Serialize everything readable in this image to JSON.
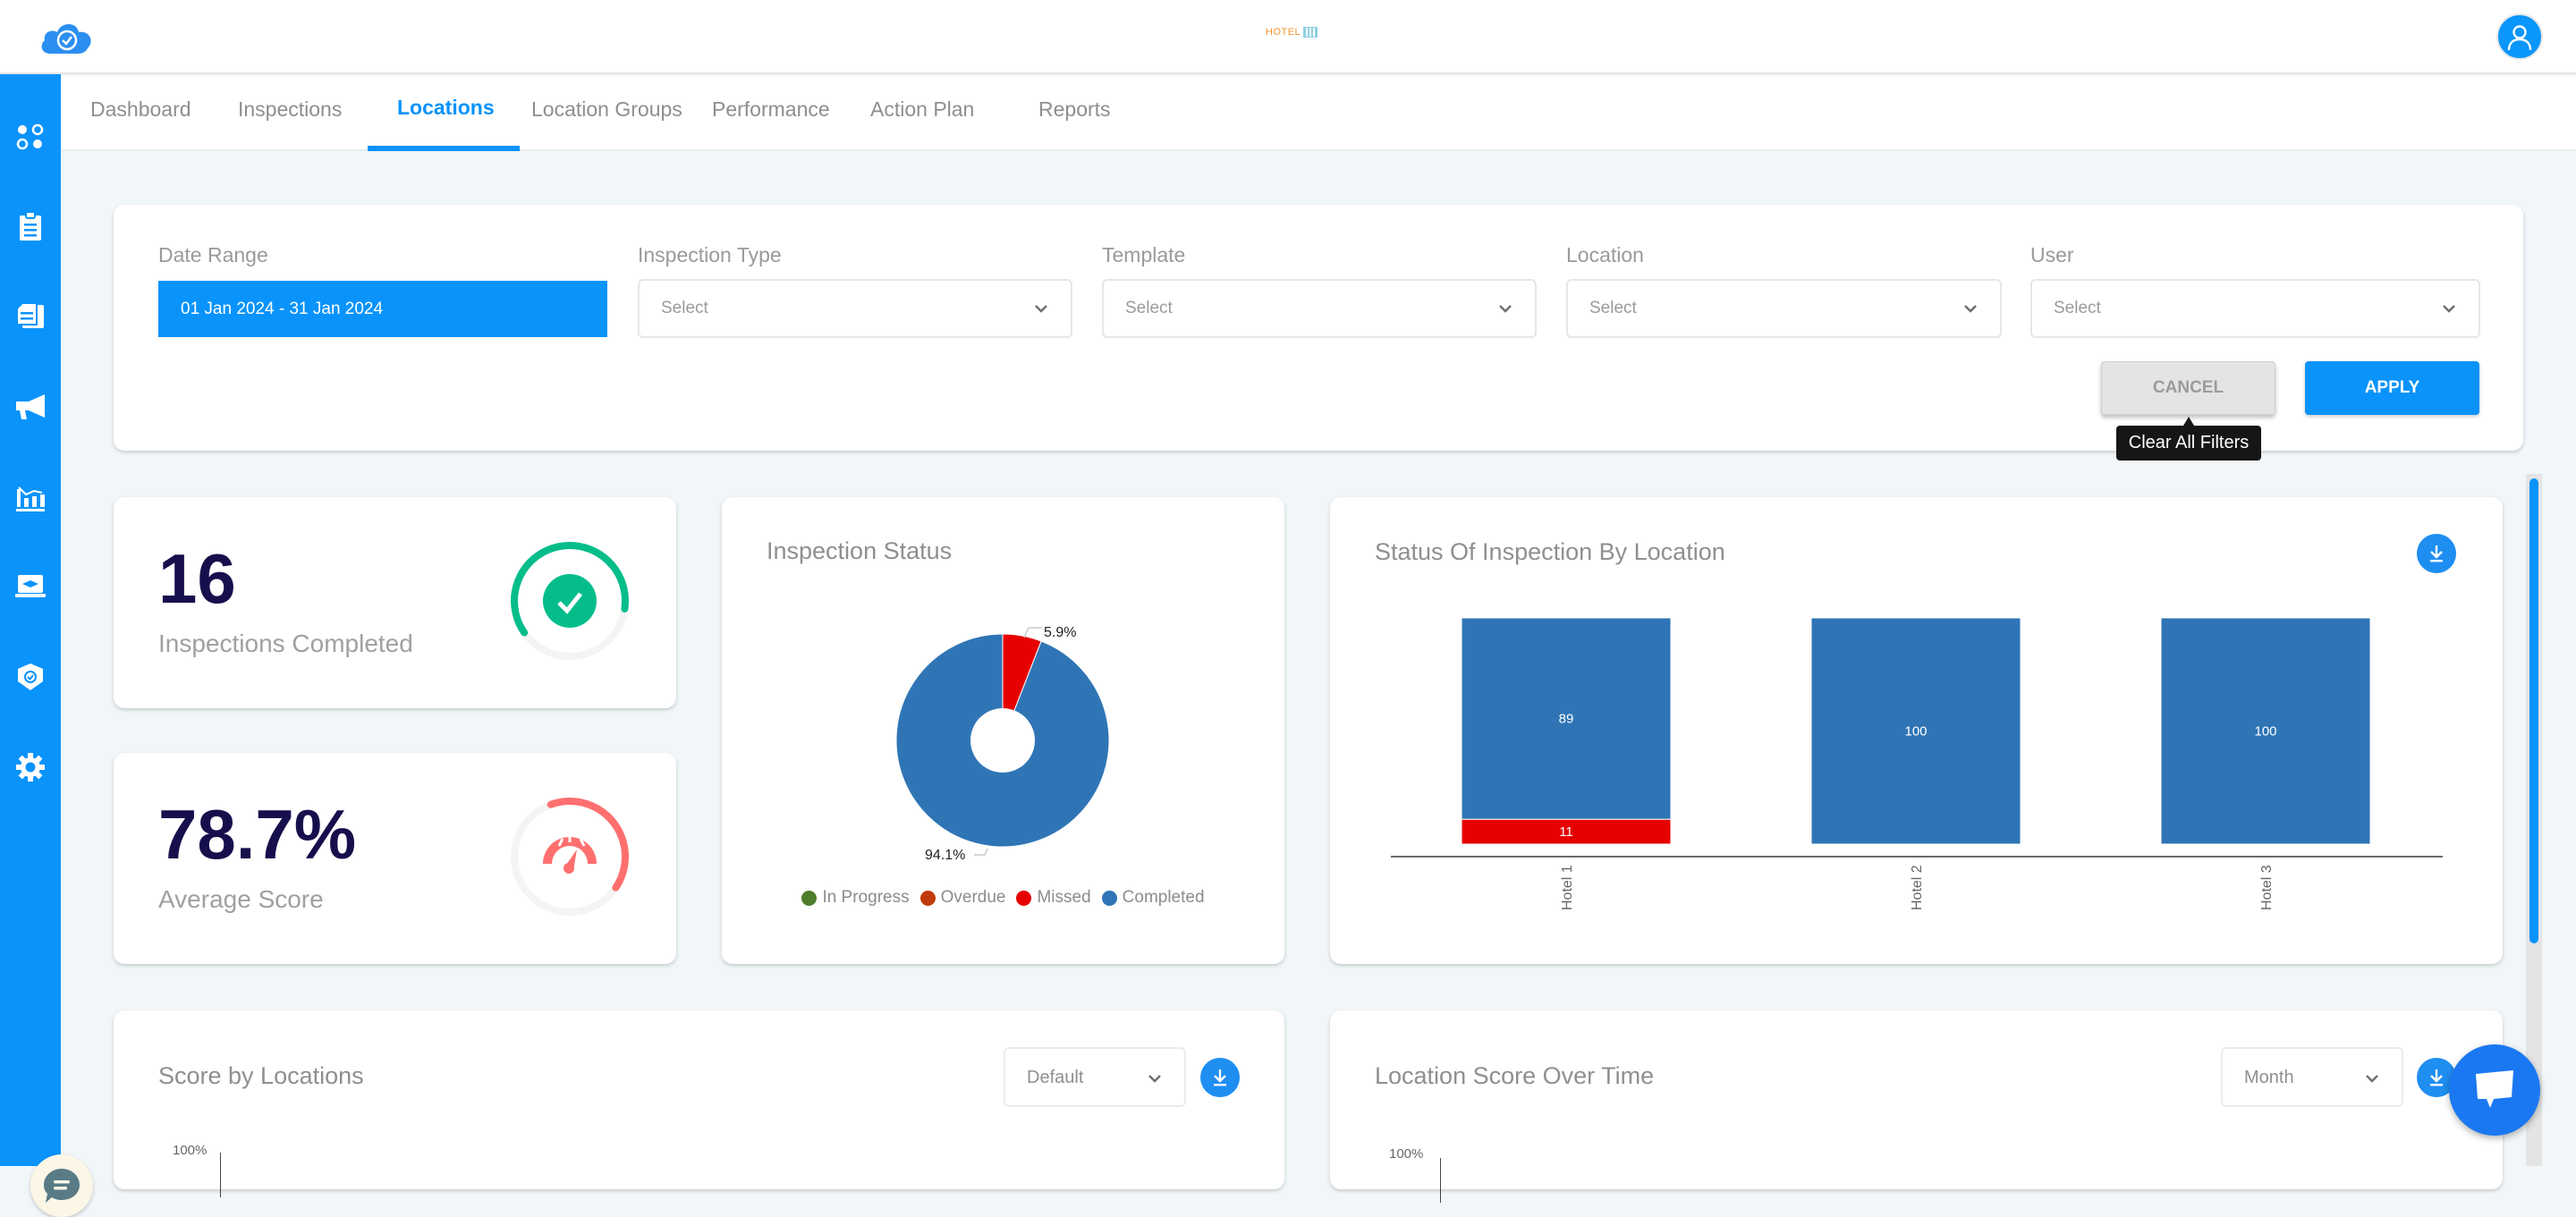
{
  "header": {
    "hotel_logo_text": "HOTEL",
    "icons": {
      "app_logo": "cloud-check-icon",
      "avatar": "user-icon"
    }
  },
  "sidebar": {
    "items": [
      {
        "icon": "apps-dots-icon"
      },
      {
        "icon": "clipboard-icon"
      },
      {
        "icon": "documents-icon"
      },
      {
        "icon": "megaphone-icon"
      },
      {
        "icon": "analytics-chart-icon"
      },
      {
        "icon": "training-laptop-icon"
      },
      {
        "icon": "shield-check-icon"
      },
      {
        "icon": "gear-icon"
      }
    ]
  },
  "tabs": [
    {
      "label": "Dashboard",
      "active": false
    },
    {
      "label": "Inspections",
      "active": false
    },
    {
      "label": "Locations",
      "active": true
    },
    {
      "label": "Location Groups",
      "active": false
    },
    {
      "label": "Performance",
      "active": false
    },
    {
      "label": "Action Plan",
      "active": false
    },
    {
      "label": "Reports",
      "active": false
    }
  ],
  "filters": {
    "date_range": {
      "label": "Date Range",
      "value": "01 Jan 2024 - 31 Jan 2024"
    },
    "inspection_type": {
      "label": "Inspection Type",
      "placeholder": "Select"
    },
    "template": {
      "label": "Template",
      "placeholder": "Select"
    },
    "location": {
      "label": "Location",
      "placeholder": "Select"
    },
    "user": {
      "label": "User",
      "placeholder": "Select"
    },
    "cancel_label": "CANCEL",
    "apply_label": "APPLY",
    "tooltip": "Clear All Filters"
  },
  "kpis": {
    "completed": {
      "value": "16",
      "label": "Inspections Completed",
      "ring_fraction": 0.62,
      "color": "#05bd8b"
    },
    "average_score": {
      "value": "78.7%",
      "label": "Average Score",
      "ring_fraction": 0.4,
      "color": "#ff6f6f"
    }
  },
  "inspection_status": {
    "title": "Inspection Status",
    "labels": {
      "missed": "5.9%",
      "completed": "94.1%"
    }
  },
  "status_by_location": {
    "title": "Status Of Inspection By Location"
  },
  "score_by_locations": {
    "title": "Score by Locations",
    "select_value": "Default",
    "y_tick_top": "100%"
  },
  "location_score_over_time": {
    "title": "Location Score Over Time",
    "select_value": "Month",
    "y_tick_top": "100%"
  },
  "colors": {
    "brand": "#0993fb",
    "in_progress": "#4e7d2c",
    "overdue": "#c13a0b",
    "missed": "#e60000",
    "completed": "#2f75b5"
  },
  "chart_data": [
    {
      "type": "pie",
      "title": "Inspection Status",
      "donut": true,
      "categories": [
        "In Progress",
        "Overdue",
        "Missed",
        "Completed"
      ],
      "values": [
        0,
        0,
        5.9,
        94.1
      ],
      "colors": [
        "#4e7d2c",
        "#c13a0b",
        "#e60000",
        "#2f75b5"
      ],
      "legend": "bottom"
    },
    {
      "type": "bar",
      "stacked": true,
      "title": "Status Of Inspection By Location",
      "categories": [
        "Hotel 1",
        "Hotel 2",
        "Hotel 3"
      ],
      "series": [
        {
          "name": "Missed",
          "values": [
            11,
            0,
            0
          ],
          "color": "#e60000"
        },
        {
          "name": "Completed",
          "values": [
            89,
            100,
            100
          ],
          "color": "#2f75b5"
        }
      ],
      "ylim": [
        0,
        100
      ],
      "xlabel": "",
      "ylabel": "",
      "grid": false
    }
  ]
}
